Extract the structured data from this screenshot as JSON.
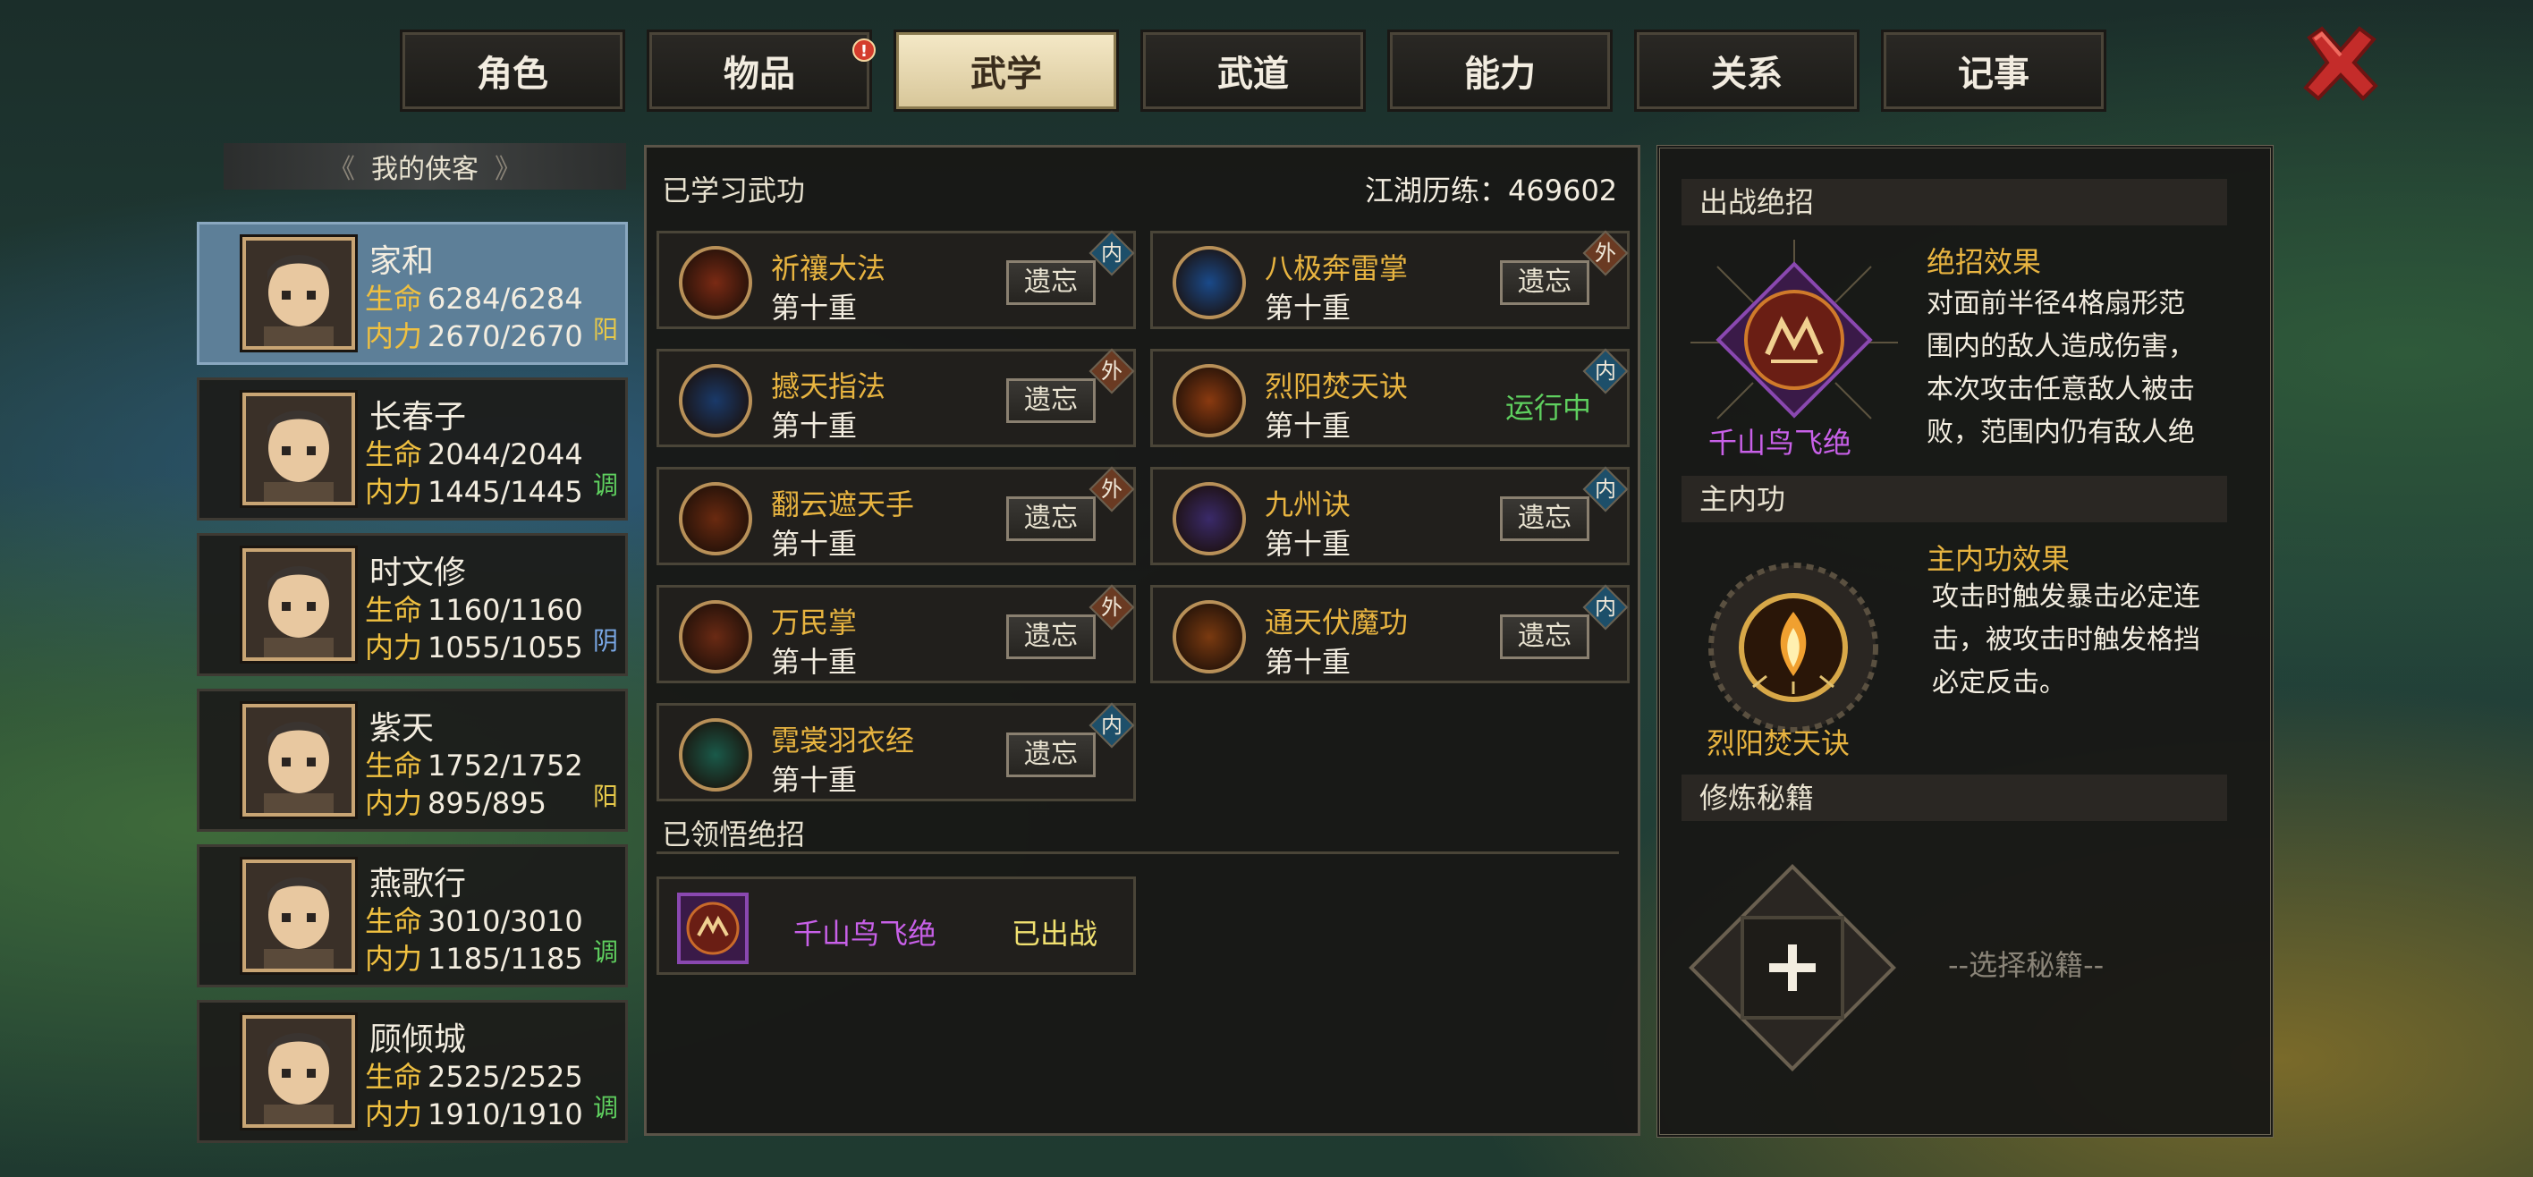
{
  "tabs": [
    {
      "label": "角色"
    },
    {
      "label": "物品",
      "badge": "!"
    },
    {
      "label": "武学",
      "active": true
    },
    {
      "label": "武道"
    },
    {
      "label": "能力"
    },
    {
      "label": "关系"
    },
    {
      "label": "记事"
    }
  ],
  "sidebar": {
    "header": "我的侠客"
  },
  "characters": [
    {
      "name": "家和",
      "hp_label": "生命",
      "hp": "6284/6284",
      "mp_label": "内力",
      "mp": "2670/2670",
      "tag": "阳",
      "tag_color": "#e6c84a",
      "active": true
    },
    {
      "name": "长春子",
      "hp_label": "生命",
      "hp": "2044/2044",
      "mp_label": "内力",
      "mp": "1445/1445",
      "tag": "调",
      "tag_color": "#5fd05f"
    },
    {
      "name": "时文修",
      "hp_label": "生命",
      "hp": "1160/1160",
      "mp_label": "内力",
      "mp": "1055/1055",
      "tag": "阴",
      "tag_color": "#7aa8e6"
    },
    {
      "name": "紫天",
      "hp_label": "生命",
      "hp": "1752/1752",
      "mp_label": "内力",
      "mp": "895/895",
      "tag": "阳",
      "tag_color": "#e6c84a"
    },
    {
      "name": "燕歌行",
      "hp_label": "生命",
      "hp": "3010/3010",
      "mp_label": "内力",
      "mp": "1185/1185",
      "tag": "调",
      "tag_color": "#5fd05f"
    },
    {
      "name": "顾倾城",
      "hp_label": "生命",
      "hp": "2525/2525",
      "mp_label": "内力",
      "mp": "1910/1910",
      "tag": "调",
      "tag_color": "#5fd05f"
    }
  ],
  "learned": {
    "title": "已学习武功",
    "exp_label": "江湖历练：469602",
    "skills": [
      {
        "name": "祈禳大法",
        "level": "第十重",
        "type": "内",
        "action": "遗忘"
      },
      {
        "name": "八极奔雷掌",
        "level": "第十重",
        "type": "外",
        "action": "遗忘"
      },
      {
        "name": "撼天指法",
        "level": "第十重",
        "type": "外",
        "action": "遗忘"
      },
      {
        "name": "烈阳焚天诀",
        "level": "第十重",
        "type": "内",
        "action": "运行中",
        "running": true
      },
      {
        "name": "翻云遮天手",
        "level": "第十重",
        "type": "外",
        "action": "遗忘"
      },
      {
        "name": "九州诀",
        "level": "第十重",
        "type": "内",
        "action": "遗忘"
      },
      {
        "name": "万民掌",
        "level": "第十重",
        "type": "外",
        "action": "遗忘"
      },
      {
        "name": "通天伏魔功",
        "level": "第十重",
        "type": "内",
        "action": "遗忘"
      },
      {
        "name": "霓裳羽衣经",
        "level": "第十重",
        "type": "内",
        "action": "遗忘"
      }
    ]
  },
  "ultimates": {
    "title": "已领悟绝招",
    "items": [
      {
        "name": "千山鸟飞绝",
        "status": "已出战"
      }
    ]
  },
  "right": {
    "battle_title": "出战绝招",
    "battle_name": "千山鸟飞绝",
    "battle_effect_title": "绝招效果",
    "battle_effect": [
      "对面前半径4格扇形范",
      "围内的敌人造成伤害，",
      "本次攻击任意敌人被击",
      "败，范围内仍有敌人绝"
    ],
    "inner_title": "主内功",
    "inner_name": "烈阳焚天诀",
    "inner_effect_title": "主内功效果",
    "inner_effect": [
      "攻击时触发暴击必定连",
      "击，被攻击时触发格挡",
      "必定反击。"
    ],
    "manual_title": "修炼秘籍",
    "manual_placeholder": "--选择秘籍--"
  }
}
